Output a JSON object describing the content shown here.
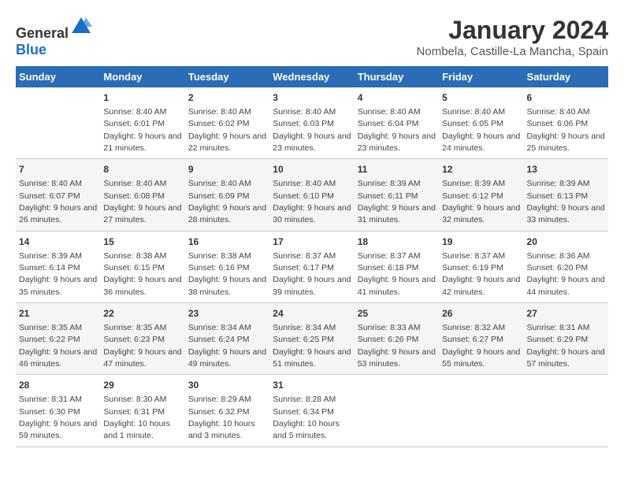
{
  "logo": {
    "text_general": "General",
    "text_blue": "Blue"
  },
  "title": "January 2024",
  "subtitle": "Nombela, Castille-La Mancha, Spain",
  "weekdays": [
    "Sunday",
    "Monday",
    "Tuesday",
    "Wednesday",
    "Thursday",
    "Friday",
    "Saturday"
  ],
  "weeks": [
    [
      {
        "num": "",
        "sunrise": "",
        "sunset": "",
        "daylight": ""
      },
      {
        "num": "1",
        "sunrise": "Sunrise: 8:40 AM",
        "sunset": "Sunset: 6:01 PM",
        "daylight": "Daylight: 9 hours and 21 minutes."
      },
      {
        "num": "2",
        "sunrise": "Sunrise: 8:40 AM",
        "sunset": "Sunset: 6:02 PM",
        "daylight": "Daylight: 9 hours and 22 minutes."
      },
      {
        "num": "3",
        "sunrise": "Sunrise: 8:40 AM",
        "sunset": "Sunset: 6:03 PM",
        "daylight": "Daylight: 9 hours and 23 minutes."
      },
      {
        "num": "4",
        "sunrise": "Sunrise: 8:40 AM",
        "sunset": "Sunset: 6:04 PM",
        "daylight": "Daylight: 9 hours and 23 minutes."
      },
      {
        "num": "5",
        "sunrise": "Sunrise: 8:40 AM",
        "sunset": "Sunset: 6:05 PM",
        "daylight": "Daylight: 9 hours and 24 minutes."
      },
      {
        "num": "6",
        "sunrise": "Sunrise: 8:40 AM",
        "sunset": "Sunset: 6:06 PM",
        "daylight": "Daylight: 9 hours and 25 minutes."
      }
    ],
    [
      {
        "num": "7",
        "sunrise": "Sunrise: 8:40 AM",
        "sunset": "Sunset: 6:07 PM",
        "daylight": "Daylight: 9 hours and 26 minutes."
      },
      {
        "num": "8",
        "sunrise": "Sunrise: 8:40 AM",
        "sunset": "Sunset: 6:08 PM",
        "daylight": "Daylight: 9 hours and 27 minutes."
      },
      {
        "num": "9",
        "sunrise": "Sunrise: 8:40 AM",
        "sunset": "Sunset: 6:09 PM",
        "daylight": "Daylight: 9 hours and 28 minutes."
      },
      {
        "num": "10",
        "sunrise": "Sunrise: 8:40 AM",
        "sunset": "Sunset: 6:10 PM",
        "daylight": "Daylight: 9 hours and 30 minutes."
      },
      {
        "num": "11",
        "sunrise": "Sunrise: 8:39 AM",
        "sunset": "Sunset: 6:11 PM",
        "daylight": "Daylight: 9 hours and 31 minutes."
      },
      {
        "num": "12",
        "sunrise": "Sunrise: 8:39 AM",
        "sunset": "Sunset: 6:12 PM",
        "daylight": "Daylight: 9 hours and 32 minutes."
      },
      {
        "num": "13",
        "sunrise": "Sunrise: 8:39 AM",
        "sunset": "Sunset: 6:13 PM",
        "daylight": "Daylight: 9 hours and 33 minutes."
      }
    ],
    [
      {
        "num": "14",
        "sunrise": "Sunrise: 8:39 AM",
        "sunset": "Sunset: 6:14 PM",
        "daylight": "Daylight: 9 hours and 35 minutes."
      },
      {
        "num": "15",
        "sunrise": "Sunrise: 8:38 AM",
        "sunset": "Sunset: 6:15 PM",
        "daylight": "Daylight: 9 hours and 36 minutes."
      },
      {
        "num": "16",
        "sunrise": "Sunrise: 8:38 AM",
        "sunset": "Sunset: 6:16 PM",
        "daylight": "Daylight: 9 hours and 38 minutes."
      },
      {
        "num": "17",
        "sunrise": "Sunrise: 8:37 AM",
        "sunset": "Sunset: 6:17 PM",
        "daylight": "Daylight: 9 hours and 39 minutes."
      },
      {
        "num": "18",
        "sunrise": "Sunrise: 8:37 AM",
        "sunset": "Sunset: 6:18 PM",
        "daylight": "Daylight: 9 hours and 41 minutes."
      },
      {
        "num": "19",
        "sunrise": "Sunrise: 8:37 AM",
        "sunset": "Sunset: 6:19 PM",
        "daylight": "Daylight: 9 hours and 42 minutes."
      },
      {
        "num": "20",
        "sunrise": "Sunrise: 8:36 AM",
        "sunset": "Sunset: 6:20 PM",
        "daylight": "Daylight: 9 hours and 44 minutes."
      }
    ],
    [
      {
        "num": "21",
        "sunrise": "Sunrise: 8:35 AM",
        "sunset": "Sunset: 6:22 PM",
        "daylight": "Daylight: 9 hours and 46 minutes."
      },
      {
        "num": "22",
        "sunrise": "Sunrise: 8:35 AM",
        "sunset": "Sunset: 6:23 PM",
        "daylight": "Daylight: 9 hours and 47 minutes."
      },
      {
        "num": "23",
        "sunrise": "Sunrise: 8:34 AM",
        "sunset": "Sunset: 6:24 PM",
        "daylight": "Daylight: 9 hours and 49 minutes."
      },
      {
        "num": "24",
        "sunrise": "Sunrise: 8:34 AM",
        "sunset": "Sunset: 6:25 PM",
        "daylight": "Daylight: 9 hours and 51 minutes."
      },
      {
        "num": "25",
        "sunrise": "Sunrise: 8:33 AM",
        "sunset": "Sunset: 6:26 PM",
        "daylight": "Daylight: 9 hours and 53 minutes."
      },
      {
        "num": "26",
        "sunrise": "Sunrise: 8:32 AM",
        "sunset": "Sunset: 6:27 PM",
        "daylight": "Daylight: 9 hours and 55 minutes."
      },
      {
        "num": "27",
        "sunrise": "Sunrise: 8:31 AM",
        "sunset": "Sunset: 6:29 PM",
        "daylight": "Daylight: 9 hours and 57 minutes."
      }
    ],
    [
      {
        "num": "28",
        "sunrise": "Sunrise: 8:31 AM",
        "sunset": "Sunset: 6:30 PM",
        "daylight": "Daylight: 9 hours and 59 minutes."
      },
      {
        "num": "29",
        "sunrise": "Sunrise: 8:30 AM",
        "sunset": "Sunset: 6:31 PM",
        "daylight": "Daylight: 10 hours and 1 minute."
      },
      {
        "num": "30",
        "sunrise": "Sunrise: 8:29 AM",
        "sunset": "Sunset: 6:32 PM",
        "daylight": "Daylight: 10 hours and 3 minutes."
      },
      {
        "num": "31",
        "sunrise": "Sunrise: 8:28 AM",
        "sunset": "Sunset: 6:34 PM",
        "daylight": "Daylight: 10 hours and 5 minutes."
      },
      {
        "num": "",
        "sunrise": "",
        "sunset": "",
        "daylight": ""
      },
      {
        "num": "",
        "sunrise": "",
        "sunset": "",
        "daylight": ""
      },
      {
        "num": "",
        "sunrise": "",
        "sunset": "",
        "daylight": ""
      }
    ]
  ]
}
